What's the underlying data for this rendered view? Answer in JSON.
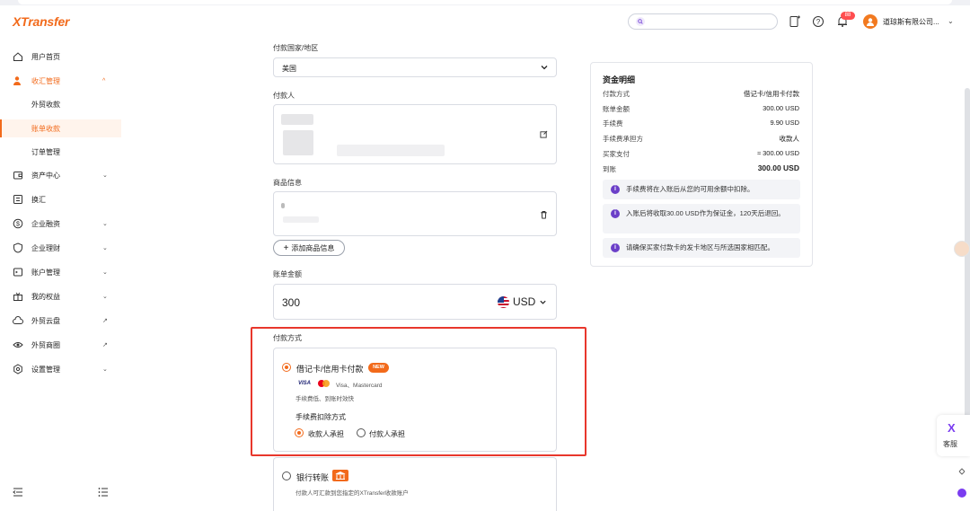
{
  "brand": {
    "logo_text": "XTransfer",
    "accent": "#f26a1b"
  },
  "header": {
    "search_placeholder": "",
    "notification_count": "88",
    "company_name": "道琼斯有限公司..."
  },
  "sidebar": {
    "items": [
      {
        "label": "用户首页"
      },
      {
        "label": "收汇管理"
      },
      {
        "label": "外贸收款"
      },
      {
        "label": "账单收款"
      },
      {
        "label": "订单管理"
      },
      {
        "label": "资产中心"
      },
      {
        "label": "换汇"
      },
      {
        "label": "企业融资"
      },
      {
        "label": "企业理财"
      },
      {
        "label": "账户管理"
      },
      {
        "label": "我的权益"
      },
      {
        "label": "外贸云盘"
      },
      {
        "label": "外贸商圈"
      },
      {
        "label": "设置管理"
      }
    ]
  },
  "form": {
    "country_label": "付款国家/地区",
    "country_value": "美国",
    "payer_label": "付款人",
    "goods_label": "商品信息",
    "add_goods_button": "添加商品信息",
    "amount_label": "账单金额",
    "amount_value": "300",
    "currency": "USD",
    "payment_method_label": "付款方式",
    "card_option": {
      "label": "借记卡/信用卡付款",
      "badge": "NEW",
      "visa_text": "VISA",
      "brands_text": "Visa、Mastercard",
      "desc": "手续费低、到账时效快",
      "fee_mode_label": "手续费扣除方式",
      "fee_options": [
        "收款人承担",
        "付款人承担"
      ],
      "selected_fee_option": "收款人承担"
    },
    "bank_option": {
      "label": "银行转账",
      "desc": "付款人可汇款到您指定的XTransfer收款账户"
    }
  },
  "summary": {
    "title": "资金明细",
    "rows": [
      {
        "label": "付款方式",
        "value": "借记卡/信用卡付款"
      },
      {
        "label": "账单金额",
        "value": "300.00 USD"
      },
      {
        "label": "手续费",
        "value": "9.90 USD"
      },
      {
        "label": "手续费承担方",
        "value": "收款人"
      },
      {
        "label": "买家支付",
        "value": "≈ 300.00 USD"
      },
      {
        "label": "到账",
        "value": "300.00 USD"
      }
    ],
    "notes": [
      "手续费将在入账后从您的可用余额中扣除。",
      "入账后将收取30.00 USD作为保证金，120天后退回。",
      "请确保买家付款卡的发卡地区与所选国家相匹配。"
    ]
  },
  "floating": {
    "service_label": "客服"
  }
}
